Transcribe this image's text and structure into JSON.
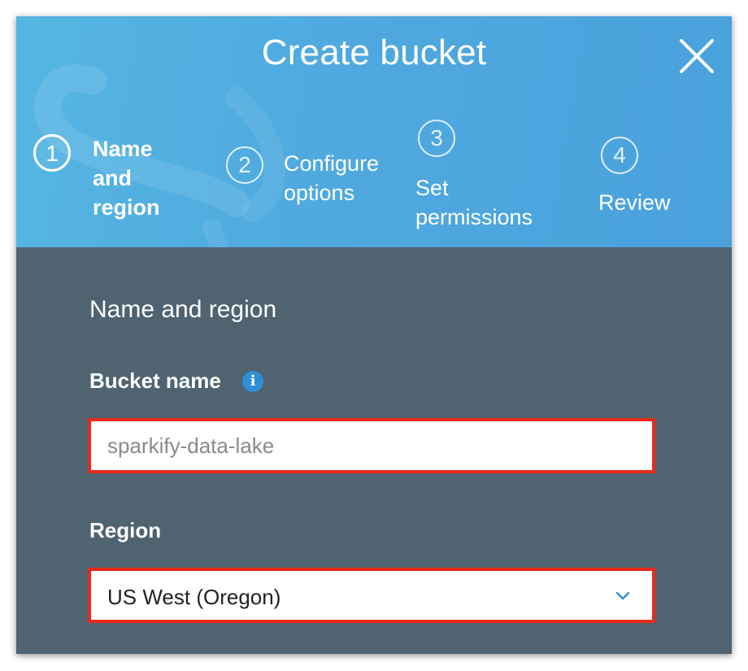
{
  "dialog": {
    "title": "Create bucket",
    "close_icon": "close-icon"
  },
  "steps": [
    {
      "number": "1",
      "label": "Name\nand\nregion",
      "active": true
    },
    {
      "number": "2",
      "label": "Configure\noptions",
      "active": false
    },
    {
      "number": "3",
      "label": "Set\npermissions",
      "active": false
    },
    {
      "number": "4",
      "label": "Review",
      "active": false
    }
  ],
  "form": {
    "section_title": "Name and region",
    "bucket_name_label": "Bucket name",
    "bucket_name_info_icon": "info-icon",
    "bucket_name_placeholder": "sparkify-data-lake",
    "bucket_name_value": "",
    "region_label": "Region",
    "region_value": "US West (Oregon)",
    "region_icon": "chevron-down-icon"
  },
  "colors": {
    "header": "#4fa9df",
    "body": "#4f6370",
    "highlight": "#e8291c",
    "info": "#2f8fd6"
  }
}
